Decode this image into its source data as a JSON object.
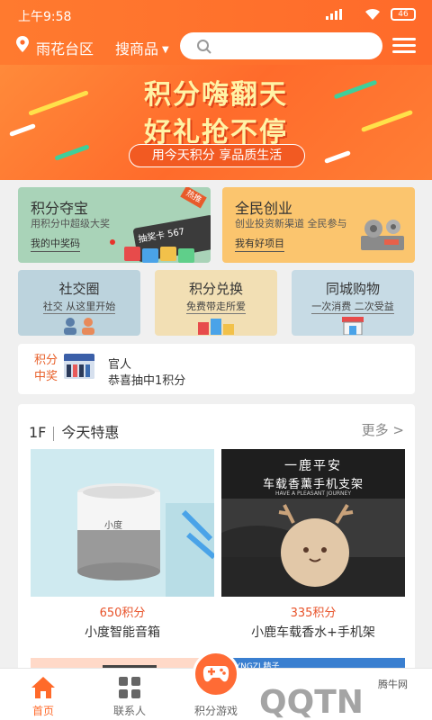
{
  "status_bar": {
    "time": "上午9:58",
    "battery": "46"
  },
  "header": {
    "location": "雨花台区",
    "category": "搜商品",
    "search_placeholder": ""
  },
  "banner": {
    "title_line1": "积分嗨翻天",
    "title_line2": "好礼抢不停",
    "subtitle": "用今天积分 享品质生活"
  },
  "cards": {
    "treasure": {
      "title": "积分夺宝",
      "desc": "用积分中超级大奖",
      "link": "我的中奖码",
      "tag": "热推",
      "ticket_text": "抽奖卡 567"
    },
    "startup": {
      "title": "全民创业",
      "desc": "创业投资新渠道 全民参与",
      "link": "我有好项目"
    }
  },
  "small_cards": [
    {
      "title": "社交圈",
      "desc": "社交 从这里开始",
      "bg": "#bcd3dd"
    },
    {
      "title": "积分兑换",
      "desc": "免费带走所爱",
      "bg": "#f2dfb4"
    },
    {
      "title": "同城购物",
      "desc": "一次消费 二次受益",
      "bg": "#c7dbe5"
    }
  ],
  "ticker": {
    "label": "积分中奖",
    "name": "官人",
    "message": "恭喜抽中1积分"
  },
  "section": {
    "floor": "1F",
    "title": "今天特惠",
    "more": "更多 >",
    "products": [
      {
        "price": "650积分",
        "name": "小度智能音箱",
        "speaker_logo": "小度"
      },
      {
        "price": "335积分",
        "name": "小鹿车载香水+手机架",
        "banner_line1": "一鹿平安",
        "banner_line2": "车载香薰手机支架",
        "banner_line3": "HAVE A PLEASANT JOURNEY"
      }
    ],
    "peek_brand": "DIYNGZI 精子"
  },
  "nav": [
    {
      "label": "首页",
      "icon": "home-icon"
    },
    {
      "label": "联系人",
      "icon": "grid-icon"
    },
    {
      "label": "积分游戏",
      "icon": "gamepad-icon"
    },
    {
      "label": "",
      "icon": ""
    },
    {
      "label": "",
      "icon": ""
    }
  ],
  "watermark": {
    "text": "腾牛网"
  },
  "colors": {
    "primary": "#ff6a2a",
    "price": "#e8532a"
  }
}
